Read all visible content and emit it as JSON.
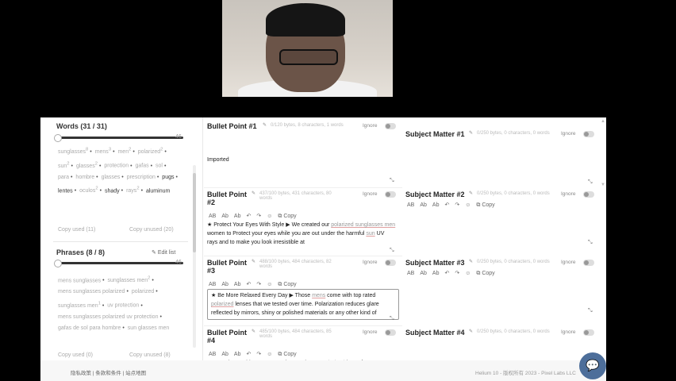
{
  "sidebar": {
    "words_title": "Words (31 / 31)",
    "words_slider_value": "46",
    "words": [
      {
        "text": "sunglasses",
        "sup": "8",
        "dark": false
      },
      {
        "text": "mens",
        "sup": "3",
        "dark": false
      },
      {
        "text": "men",
        "sup": "2",
        "dark": false
      },
      {
        "text": "polarized",
        "sup": "2",
        "dark": false
      },
      {
        "text": "sun",
        "sup": "2",
        "dark": false
      },
      {
        "text": "glasses",
        "sup": "2",
        "dark": false
      },
      {
        "text": "protection",
        "sup": "",
        "dark": false
      },
      {
        "text": "gafas",
        "sup": "",
        "dark": false
      },
      {
        "text": "sol",
        "sup": "",
        "dark": false
      },
      {
        "text": "para",
        "sup": "",
        "dark": false
      },
      {
        "text": "hombre",
        "sup": "",
        "dark": false
      },
      {
        "text": "glasses",
        "sup": "",
        "dark": false
      },
      {
        "text": "prescription",
        "sup": "",
        "dark": false
      },
      {
        "text": "pugs",
        "sup": "",
        "dark": true
      },
      {
        "text": "lentes",
        "sup": "",
        "dark": true
      },
      {
        "text": "oculos",
        "sup": "2",
        "dark": false
      },
      {
        "text": "shady",
        "sup": "",
        "dark": true
      },
      {
        "text": "rays",
        "sup": "2",
        "dark": false
      },
      {
        "text": "aluminum",
        "sup": "",
        "dark": true
      }
    ],
    "copy_used_words": "Copy used (11)",
    "copy_unused_words": "Copy unused (20)",
    "phrases_title": "Phrases (8 / 8)",
    "edit_list": "Edit list",
    "phrases_slider_value": "46",
    "phrases": [
      {
        "text": "mens sunglasses",
        "sup": "",
        "dark": false
      },
      {
        "text": "sunglasses men",
        "sup": "2",
        "dark": false
      },
      {
        "text": "mens sunglasses polarized",
        "sup": "",
        "dark": false
      },
      {
        "text": "polarized",
        "sup": "",
        "dark": false
      },
      {
        "text": "sunglasses men",
        "sup": "1",
        "dark": false
      },
      {
        "text": "uv protection",
        "sup": "",
        "dark": false
      },
      {
        "text": "mens sunglasses polarized uv protection",
        "sup": "",
        "dark": false
      },
      {
        "text": "gafas de sol para hombre",
        "sup": "",
        "dark": false
      },
      {
        "text": "sun glasses men",
        "sup": "",
        "dark": false
      }
    ],
    "copy_used_phrases": "Copy used (0)",
    "copy_unused_phrases": "Copy unused (8)"
  },
  "toolbar": {
    "uppercase": "AB",
    "titlecase": "Ab",
    "sentence": "Ab",
    "undo": "↶",
    "redo": "↷",
    "emoji": "☺",
    "copy": "Copy"
  },
  "bullets": [
    {
      "title": "Bullet Point #1",
      "meta": "0/120 bytes, 8 characters, 1 words",
      "ignore": "Ignore",
      "text": "Imported",
      "show_toolbar": false
    },
    {
      "title": "Bullet Point #2",
      "meta": "437/100 bytes, 431 characters, 80 words",
      "ignore": "Ignore",
      "text_parts": [
        "★ Protect Your Eyes With Style ▶ We created our ",
        "polarized sunglasses men",
        " women to Protect your eyes while you are out under the harmful ",
        "sun",
        " UV rays and to make you look irresistible at"
      ],
      "show_toolbar": true
    },
    {
      "title": "Bullet Point #3",
      "meta": "488/100 bytes, 484 characters, 82 words",
      "ignore": "Ignore",
      "text_parts": [
        "★ Be More Relaxed Every Day ▶ Those ",
        "mens",
        " come with top rated ",
        "polarized",
        " lenses that we tested over time. Polarization reduces glare reflected by mirrors, shiny or polished materials or any other kind of"
      ],
      "show_toolbar": true
    },
    {
      "title": "Bullet Point #4",
      "meta": "485/100 bytes, 484 characters, 85 words",
      "ignore": "Ignore",
      "text_parts": [
        "★ See The World In Its True Colors ▶ The HD ",
        "polarized",
        " lens of our"
      ],
      "show_toolbar": true
    }
  ],
  "subjects": [
    {
      "title": "Subject Matter #1",
      "meta": "0/250 bytes, 0 characters, 0 words",
      "ignore": "Ignore",
      "show_toolbar": false
    },
    {
      "title": "Subject Matter #2",
      "meta": "0/250 bytes, 0 characters, 0 words",
      "ignore": "Ignore",
      "show_toolbar": true
    },
    {
      "title": "Subject Matter #3",
      "meta": "0/250 bytes, 0 characters, 0 words",
      "ignore": "Ignore",
      "show_toolbar": true
    },
    {
      "title": "Subject Matter #4",
      "meta": "0/250 bytes, 0 characters, 0 words",
      "ignore": "Ignore",
      "show_toolbar": false
    }
  ],
  "footer": {
    "links": "隐私政策 | 条款和条件 | 站点地图",
    "copyright": "Helium 10 - 版权所有 2023 - Pixel Labs LLC"
  },
  "chat_icon": "chat-bubble-icon"
}
